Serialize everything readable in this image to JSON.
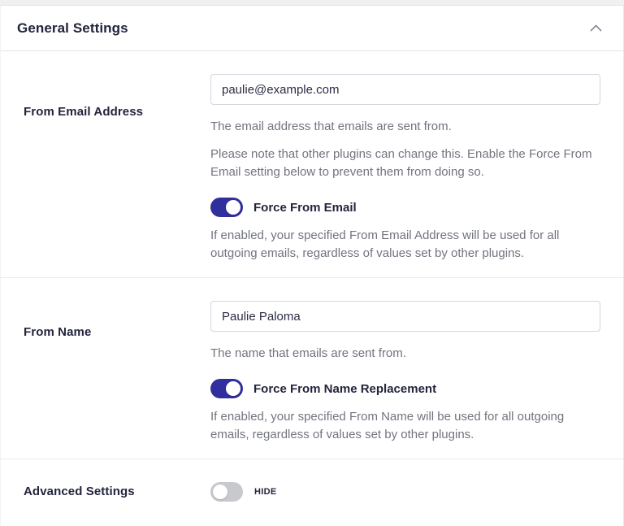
{
  "panel": {
    "title": "General Settings",
    "collapse_icon": "chevron-up"
  },
  "colors": {
    "accent": "#312e9e",
    "toggle_off": "#c7c9cf",
    "heading": "#23243c",
    "muted": "#72747f"
  },
  "rows": {
    "from_email": {
      "label": "From Email Address",
      "value": "paulie@example.com",
      "help": "The email address that emails are sent from.",
      "note": "Please note that other plugins can change this. Enable the Force From Email setting below to prevent them from doing so.",
      "toggle_label": "Force From Email",
      "toggle_state": "on",
      "toggle_desc": "If enabled, your specified From Email Address will be used for all outgoing emails, regardless of values set by other plugins."
    },
    "from_name": {
      "label": "From Name",
      "value": "Paulie Paloma",
      "help": "The name that emails are sent from.",
      "toggle_label": "Force From Name Replacement",
      "toggle_state": "on",
      "toggle_desc": "If enabled, your specified From Name will be used for all outgoing emails, regardless of values set by other plugins."
    },
    "advanced": {
      "label": "Advanced Settings",
      "toggle_label": "HIDE",
      "toggle_state": "off"
    }
  }
}
